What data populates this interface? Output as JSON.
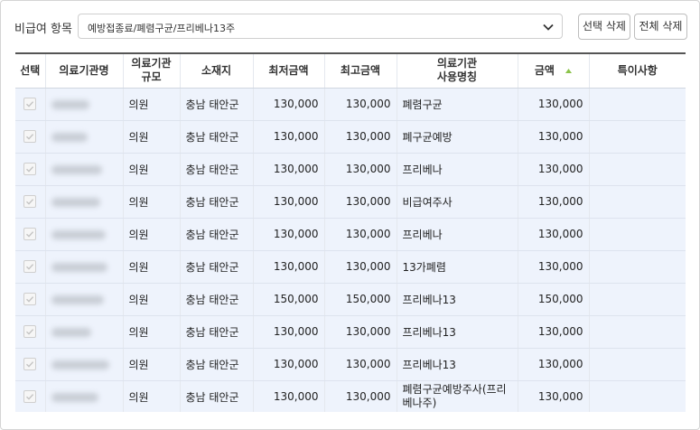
{
  "filter": {
    "label": "비급여 항목",
    "selected": "예방접종료/폐렴구균/프리베나13주"
  },
  "buttons": {
    "delete_selected": "선택 삭제",
    "delete_all": "전체 삭제"
  },
  "table": {
    "headers": {
      "select": "선택",
      "name": "의료기관명",
      "scale_line1": "의료기관",
      "scale_line2": "규모",
      "location": "소재지",
      "min": "최저금액",
      "max": "최고금액",
      "usage_line1": "의료기관",
      "usage_line2": "사용명칭",
      "amount": "금액",
      "note": "특이사항"
    },
    "sort_column": "amount",
    "sort_direction": "asc",
    "rows": [
      {
        "scale": "의원",
        "location": "충남 태안군",
        "min": "130,000",
        "max": "130,000",
        "usage": "폐렴구균",
        "amount": "130,000",
        "note": ""
      },
      {
        "scale": "의원",
        "location": "충남 태안군",
        "min": "130,000",
        "max": "130,000",
        "usage": "폐구균예방",
        "amount": "130,000",
        "note": ""
      },
      {
        "scale": "의원",
        "location": "충남 태안군",
        "min": "130,000",
        "max": "130,000",
        "usage": "프리베나",
        "amount": "130,000",
        "note": ""
      },
      {
        "scale": "의원",
        "location": "충남 태안군",
        "min": "130,000",
        "max": "130,000",
        "usage": "비급여주사",
        "amount": "130,000",
        "note": ""
      },
      {
        "scale": "의원",
        "location": "충남 태안군",
        "min": "130,000",
        "max": "130,000",
        "usage": "프리베나",
        "amount": "130,000",
        "note": ""
      },
      {
        "scale": "의원",
        "location": "충남 태안군",
        "min": "130,000",
        "max": "130,000",
        "usage": "13가폐렴",
        "amount": "130,000",
        "note": ""
      },
      {
        "scale": "의원",
        "location": "충남 태안군",
        "min": "150,000",
        "max": "150,000",
        "usage": "프리베나13",
        "amount": "150,000",
        "note": ""
      },
      {
        "scale": "의원",
        "location": "충남 태안군",
        "min": "130,000",
        "max": "130,000",
        "usage": "프리베나13",
        "amount": "130,000",
        "note": ""
      },
      {
        "scale": "의원",
        "location": "충남 태안군",
        "min": "130,000",
        "max": "130,000",
        "usage": "프리베나13",
        "amount": "130,000",
        "note": ""
      },
      {
        "scale": "의원",
        "location": "충남 태안군",
        "min": "130,000",
        "max": "130,000",
        "usage": "폐렴구균예방주사(프리베나주)",
        "amount": "130,000",
        "note": ""
      }
    ]
  },
  "colors": {
    "row_background": "#eef3fc",
    "sort_indicator": "#8bc34a",
    "header_rule": "#555555"
  },
  "icons": {
    "dropdown": "chevron-down-icon",
    "checkbox": "check-icon",
    "sort": "sort-asc-icon"
  }
}
